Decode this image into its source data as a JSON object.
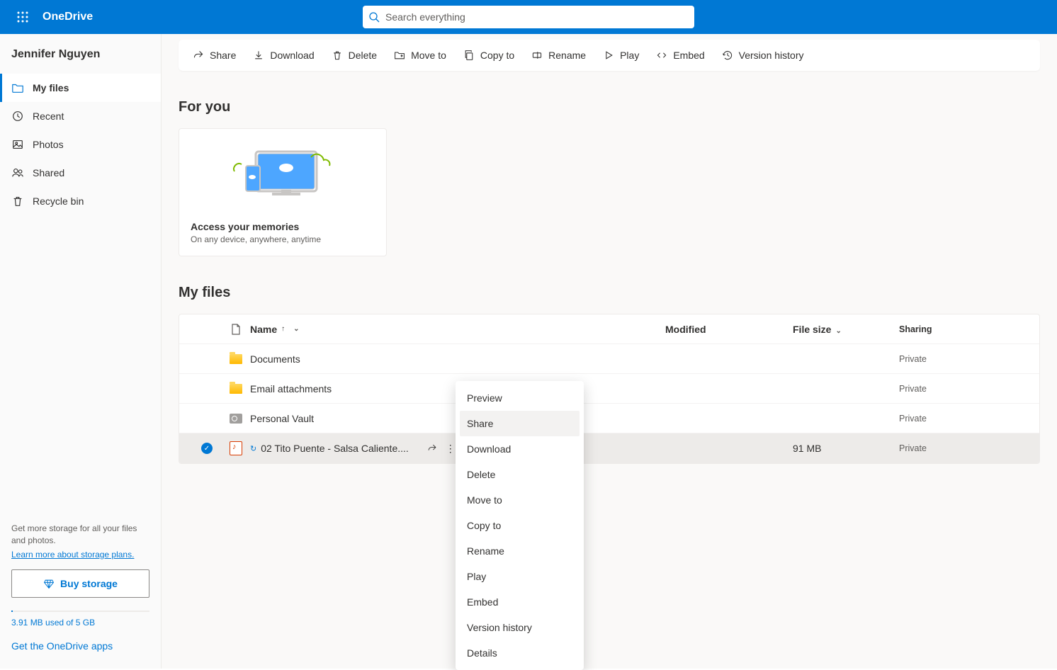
{
  "header": {
    "brand": "OneDrive",
    "search_placeholder": "Search everything"
  },
  "sidebar": {
    "user_name": "Jennifer Nguyen",
    "nav": [
      {
        "label": "My files"
      },
      {
        "label": "Recent"
      },
      {
        "label": "Photos"
      },
      {
        "label": "Shared"
      },
      {
        "label": "Recycle bin"
      }
    ],
    "storage_hint": "Get more storage for all your files and photos.",
    "learn_more": "Learn more about storage plans.",
    "buy_label": "Buy storage",
    "storage_used": "3.91 MB used of 5 GB",
    "get_apps": "Get the OneDrive apps"
  },
  "cmdbar": [
    "Share",
    "Download",
    "Delete",
    "Move to",
    "Copy to",
    "Rename",
    "Play",
    "Embed",
    "Version history"
  ],
  "for_you": {
    "title": "For you",
    "card_title": "Access your memories",
    "card_sub": "On any device, anywhere, anytime"
  },
  "my_files": {
    "title": "My files",
    "columns": {
      "name": "Name",
      "modified": "Modified",
      "size": "File size",
      "sharing": "Sharing"
    },
    "rows": [
      {
        "type": "folder",
        "name": "Documents",
        "size": "",
        "sharing": "Private"
      },
      {
        "type": "folder",
        "name": "Email attachments",
        "size": "",
        "sharing": "Private"
      },
      {
        "type": "vault",
        "name": "Personal Vault",
        "size": "",
        "sharing": "Private"
      },
      {
        "type": "audio",
        "name": "02 Tito Puente - Salsa Caliente....",
        "size": "91 MB",
        "sharing": "Private",
        "selected": true
      }
    ]
  },
  "context_menu": [
    "Preview",
    "Share",
    "Download",
    "Delete",
    "Move to",
    "Copy to",
    "Rename",
    "Play",
    "Embed",
    "Version history",
    "Details"
  ],
  "context_hovered": "Share"
}
